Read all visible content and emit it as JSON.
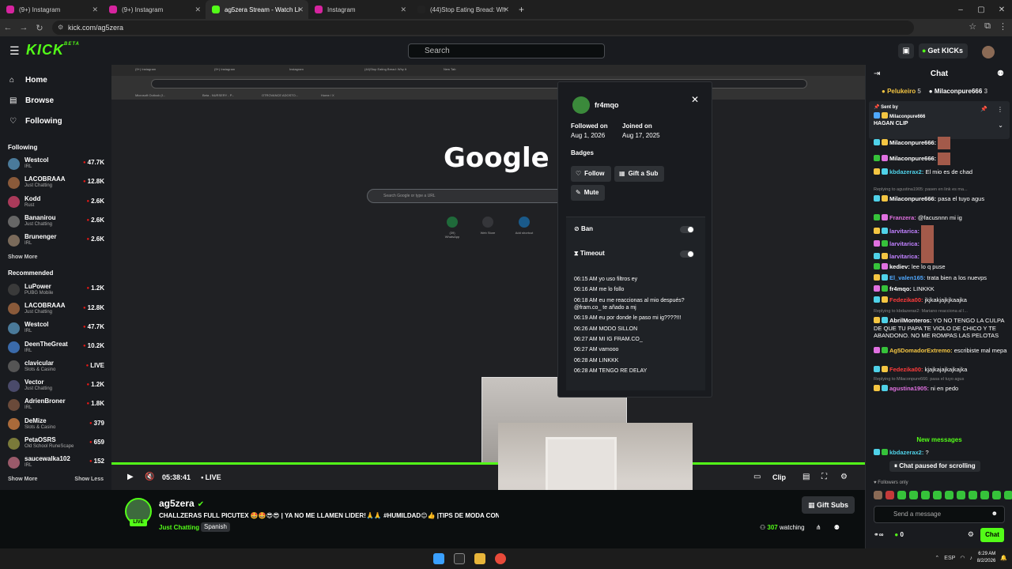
{
  "browser": {
    "tabs": [
      {
        "label": "(9+) Instagram",
        "color": "#d6249f"
      },
      {
        "label": "(9+) Instagram",
        "color": "#d6249f"
      },
      {
        "label": "ag5zera Stream - Watch Live on",
        "color": "#53fc18",
        "active": true
      },
      {
        "label": "Instagram",
        "color": "#d6249f"
      },
      {
        "label": "(44)Stop Eating Bread: Why It",
        "color": "#222222"
      }
    ],
    "new_tab": "+",
    "url": "kick.com/ag5zera"
  },
  "header": {
    "logo": "KICK",
    "logo_beta": "BETA",
    "search_placeholder": "Search",
    "get_kicks": "Get KICKs"
  },
  "sidebar": {
    "nav": [
      {
        "label": "Home",
        "icon": "home-icon"
      },
      {
        "label": "Browse",
        "icon": "browse-icon"
      },
      {
        "label": "Following",
        "icon": "heart-icon"
      }
    ],
    "following_title": "Following",
    "following": [
      {
        "name": "Westcol",
        "cat": "IRL",
        "viewers": "47.7K",
        "color": "#4a7a9a"
      },
      {
        "name": "LACOBRAAA",
        "cat": "Just Chatting",
        "viewers": "12.8K",
        "color": "#8a5a3a"
      },
      {
        "name": "Kodd",
        "cat": "Rust",
        "viewers": "2.6K",
        "color": "#aa3a5a"
      },
      {
        "name": "Bananirou",
        "cat": "Just Chatting",
        "viewers": "2.6K",
        "color": "#666666"
      },
      {
        "name": "Brunenger",
        "cat": "IRL",
        "viewers": "2.6K",
        "color": "#7a6a5a"
      }
    ],
    "show_more_1": "Show More",
    "recommended_title": "Recommended",
    "recommended": [
      {
        "name": "LuPower",
        "cat": "PUBG Mobile",
        "viewers": "1.2K",
        "color": "#3a3a3a"
      },
      {
        "name": "LACOBRAAA",
        "cat": "Just Chatting",
        "viewers": "12.8K",
        "color": "#8a5a3a"
      },
      {
        "name": "Westcol",
        "cat": "IRL",
        "viewers": "47.7K",
        "color": "#4a7a9a"
      },
      {
        "name": "DeenTheGreat",
        "cat": "IRL",
        "viewers": "10.2K",
        "color": "#3a6aaa"
      },
      {
        "name": "clavicular",
        "cat": "Slots & Casino",
        "viewers": "LIVE",
        "color": "#555555"
      },
      {
        "name": "Vector",
        "cat": "Just Chatting",
        "viewers": "1.2K",
        "color": "#4a4a6a"
      },
      {
        "name": "AdrienBroner",
        "cat": "IRL",
        "viewers": "1.8K",
        "color": "#6a4a3a"
      },
      {
        "name": "DeMize",
        "cat": "Slots & Casino",
        "viewers": "379",
        "color": "#aa6a3a"
      },
      {
        "name": "PetaOSRS",
        "cat": "Old School RuneScape",
        "viewers": "659",
        "color": "#7a7a3a"
      },
      {
        "name": "saucewalka102",
        "cat": "IRL",
        "viewers": "152",
        "color": "#9a5a6a"
      }
    ],
    "show_more_2": "Show More",
    "show_less": "Show Less"
  },
  "video": {
    "inner_tabs": [
      "(9+) Instagram",
      "(9+) Instagram",
      "Instagram",
      "(44)Stop Eating Bread: Why It",
      "New Tab"
    ],
    "bookmarks": [
      "Microsoft Outlook (f...",
      "Beta - NURSERY - P...",
      "OTROVANCE ADOSTO...",
      "Home / X"
    ],
    "google": "Google",
    "google_search": "Search Google or type a URL",
    "shortcuts": [
      "(39) WhatsApp",
      "Web Store",
      "Add shortcut"
    ],
    "time": "05:38:41",
    "live": "LIVE",
    "clip": "Clip",
    "progress": 1.0
  },
  "usercard": {
    "username": "fr4mqo",
    "followed_label": "Followed on",
    "followed_value": "Aug 1, 2026",
    "joined_label": "Joined on",
    "joined_value": "Aug 17, 2025",
    "badges_label": "Badges",
    "follow": "Follow",
    "gift": "Gift a Sub",
    "mute": "Mute",
    "ban": "Ban",
    "timeout": "Timeout",
    "messages": [
      "06:15 AM yo uso filtros ey",
      "06:16 AM me lo follo",
      "06:18 AM eu me reaccionas al mio después? @fram.co_ te añado a mj",
      "06:19 AM eu por donde le paso mi ig????!!!",
      "06:26 AM MODO SILLON",
      "06:27 AM MI IG FRAM.CO_",
      "06:27 AM vamooo",
      "06:28 AM LINKKK",
      "06:28 AM TENGO RE DELAY"
    ]
  },
  "stream": {
    "name": "ag5zera",
    "live_badge": "LIVE",
    "title": "CHALLZERAS FULL PICUTEX 🤩🤩😎😎 | YA NO ME LLAMEN LIDER!🙏🙏 #HUMILDAD😊👍 |TIPS DE MODA CON",
    "category": "Just Chatting",
    "tag": "Spanish",
    "gift_subs": "Gift Subs",
    "watching_count": "307",
    "watching_label": "watching"
  },
  "chat": {
    "title": "Chat",
    "leaders": [
      {
        "name": "Pelukeiro",
        "n": "5"
      },
      {
        "name": "Milaconpure666",
        "n": "3"
      }
    ],
    "pinned_label": "Sent by",
    "pinned_user": "Milaconpure666",
    "pinned_text": "HAGAN CLIP",
    "messages": [
      {
        "u": "Milaconpure666:",
        "t": "",
        "c": "#ffffff",
        "emote": true
      },
      {
        "u": "Milaconpure666:",
        "t": "",
        "c": "#ffffff",
        "emote": true
      },
      {
        "u": "kbdazerax2:",
        "t": "El mio es de chad",
        "c": "#4fd1e8"
      },
      {
        "reply": "Replying to agustina1905: pasen en link es ma..."
      },
      {
        "u": "Milaconpure666:",
        "t": "pasa el tuyo agus",
        "c": "#ffffff"
      },
      {
        "u": "Franzera:",
        "t": "@facusnnn mi ig",
        "c": "#e070e0"
      },
      {
        "u": "larvitarica:",
        "t": "",
        "c": "#c080ff",
        "emote": true
      },
      {
        "u": "larvitarica:",
        "t": "",
        "c": "#c080ff",
        "emote": true
      },
      {
        "u": "larvitarica:",
        "t": "",
        "c": "#c080ff",
        "emote": true
      },
      {
        "u": "kediev:",
        "t": "lee lo q puse",
        "c": "#ffffff"
      },
      {
        "u": "El_valen165:",
        "t": "trata bien a los nuevps",
        "c": "#4fa8ff"
      },
      {
        "u": "fr4mqo:",
        "t": "LINKKK",
        "c": "#ffffff"
      },
      {
        "u": "Fedezika00:",
        "t": "jkjkakjajkjkaajka",
        "c": "#ff3b3b"
      },
      {
        "reply": "Replying to kbdazerax2: Mariano reacciona al l..."
      },
      {
        "u": "AbrilMonteros:",
        "t": "YO NO TENGO LA CULPA DE QUE TU PAPA TE VIOLO DE CHICO Y TE ABANDONO. NO ME ROMPAS LAS PELOTAS",
        "c": "#ffffff"
      },
      {
        "u": "Ag5DomadorExtremo:",
        "t": "escribiste mal mepa",
        "c": "#f4c542"
      },
      {
        "u": "Fedezika00:",
        "t": "kjajkajajkajkajka",
        "c": "#ff3b3b"
      },
      {
        "reply": "Replying to Milaconpure666: pasa el tuyo agus"
      },
      {
        "u": "agustina1905:",
        "t": "ni en pedo",
        "c": "#e070e0"
      }
    ],
    "new_messages": "New messages",
    "new_msg_user": "kbdazerax2:",
    "new_msg_text": "?",
    "paused": "Chat paused for scrolling",
    "followers_only": "Followers only",
    "send_placeholder": "Send a message",
    "kicks_count": "0",
    "chat_button": "Chat"
  },
  "taskbar": {
    "lang": "ESP",
    "time": "6:29 AM",
    "date": "8/2/2026"
  }
}
